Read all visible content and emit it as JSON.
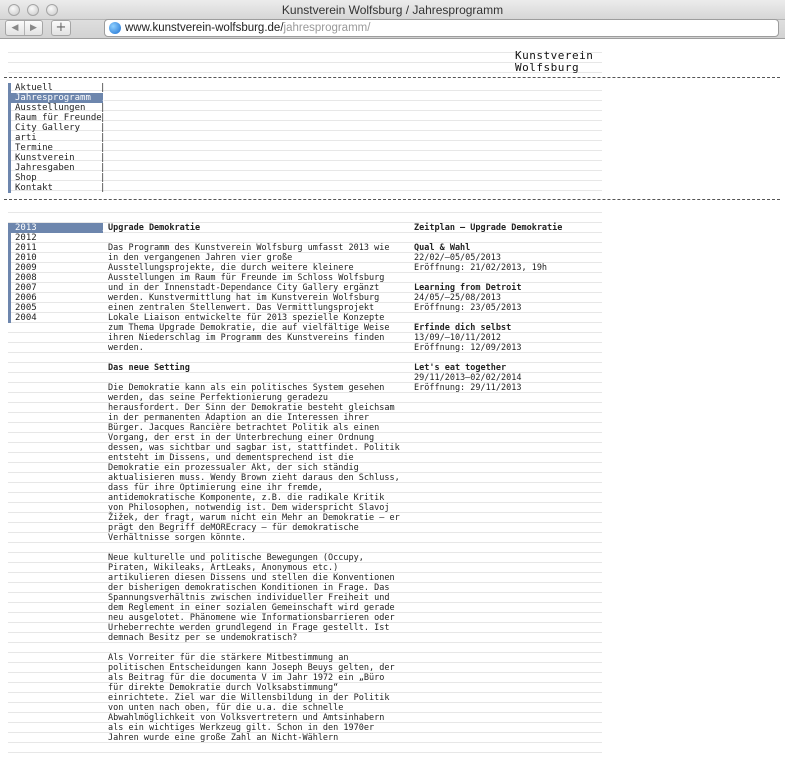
{
  "window": {
    "title": "Kunstverein Wolfsburg / Jahresprogramm",
    "nav_back": "◀",
    "nav_forward": "▶",
    "new_tab": "+"
  },
  "url": {
    "host": "www.kunstverein-wolfsburg.de/",
    "path": "jahresprogramm/"
  },
  "logo": {
    "line1": "Kunstverein",
    "line2": "Wolfsburg"
  },
  "menu": {
    "items": [
      {
        "label": "Aktuell"
      },
      {
        "label": "Jahresprogramm"
      },
      {
        "label": "Ausstellungen"
      },
      {
        "label": "Raum für Freunde"
      },
      {
        "label": "City Gallery"
      },
      {
        "label": "arti"
      },
      {
        "label": "Termine"
      },
      {
        "label": "Kunstverein"
      },
      {
        "label": "Jahresgaben"
      },
      {
        "label": "Shop"
      },
      {
        "label": "Kontakt"
      }
    ],
    "active_marker": "/",
    "separator": "|"
  },
  "years": {
    "items": [
      "2013",
      "2012",
      "2011",
      "2010",
      "2009",
      "2008",
      "2007",
      "2006",
      "2005",
      "2004"
    ]
  },
  "article": {
    "title": "Upgrade Demokratie",
    "intro": "Das Programm des Kunstverein Wolfsburg umfasst 2013 wie in den vergangenen Jahren vier große Ausstellungsprojekte, die durch weitere kleinere Ausstellungen im Raum für Freunde im Schloss Wolfsburg und in der Innenstadt-Dependance City Gallery ergänzt werden. Kunstvermittlung hat im Kunstverein Wolfsburg einen zentralen Stellenwert. Das Vermittlungsprojekt Lokale Liaison entwickelte für 2013 spezielle Konzepte zum Thema Upgrade Demokratie, die auf vielfältige Weise ihren Niederschlag im Programm des Kunstvereins finden werden.",
    "section_title": "Das neue Setting",
    "p1": "Die Demokratie kann als ein politisches System gesehen werden, das seine Perfektionierung geradezu herausfordert. Der Sinn der Demokratie besteht gleichsam in der permanenten Adaption an die Interessen ihrer Bürger. Jacques Rancière betrachtet Politik als einen Vorgang, der erst in der Unterbrechung einer Ordnung dessen, was sichtbar und sagbar ist, stattfindet. Politik entsteht im Dissens, und dementsprechend ist die Demokratie ein prozessualer Akt, der sich ständig aktualisieren muss. Wendy Brown zieht daraus den Schluss, dass für ihre Optimierung eine ihr fremde, antidemokratische Komponente, z.B. die radikale Kritik von Philosophen, notwendig ist. Dem widerspricht Slavoj Žižek, der fragt, warum nicht ein Mehr an Demokratie – er prägt den Begriff deMOREcracy – für demokratische Verhältnisse sorgen könnte.",
    "p2": "Neue kulturelle und politische Bewegungen (Occupy, Piraten, Wikileaks, ArtLeaks, Anonymous etc.) artikulieren diesen Dissens und stellen die Konventionen der bisherigen demokratischen Konditionen in Frage. Das Spannungsverhältnis zwischen individueller Freiheit und dem Reglement in einer sozialen Gemeinschaft wird gerade neu ausgelotet. Phänomene wie Informationsbarrieren oder Urheberrechte werden grundlegend in Frage gestellt. Ist demnach Besitz per se undemokratisch?",
    "p3": "Als Vorreiter für die stärkere Mitbestimmung an politischen Entscheidungen kann Joseph Beuys gelten, der als Beitrag für die documenta V im Jahr 1972 ein „Büro für direkte Demokratie durch Volksabstimmung“ einrichtete. Ziel war die Willensbildung in der Politik von unten nach oben, für die u.a. die schnelle Abwahlmöglichkeit von Volksvertretern und Amtsinhabern als ein wichtiges Werkzeug gilt. Schon in den 1970er Jahren wurde eine große Zahl an Nicht-Wählern"
  },
  "schedule": {
    "title": "Zeitplan – Upgrade Demokratie",
    "events": [
      {
        "title": "Qual & Wahl",
        "dates": "22/02/–05/05/2013",
        "opening": "Eröffnung: 21/02/2013, 19h"
      },
      {
        "title": "Learning from Detroit",
        "dates": "24/05/–25/08/2013",
        "opening": "Eröffnung: 23/05/2013"
      },
      {
        "title": "Erfinde dich selbst",
        "dates": "13/09/–10/11/2012",
        "opening": "Eröffnung: 12/09/2013"
      },
      {
        "title": "Let's eat together",
        "dates": "29/11/2013–02/02/2014",
        "opening": "Eröffnung: 29/11/2013"
      }
    ]
  },
  "colors": {
    "accent": "#6d86ad",
    "text": "#222222",
    "rule": "#555555"
  }
}
